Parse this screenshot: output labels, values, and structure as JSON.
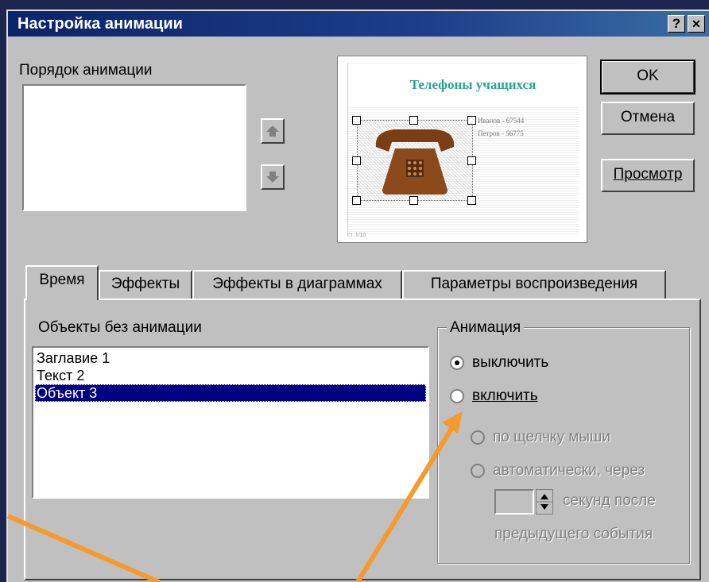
{
  "window": {
    "title": "Настройка анимации",
    "help_label": "?",
    "close_label": "✕"
  },
  "order": {
    "label": "Порядок анимации"
  },
  "buttons": {
    "ok": "OK",
    "cancel": "Отмена",
    "preview": "Просмотр"
  },
  "preview": {
    "slide_title": "Телефоны учащихся",
    "line1": "Иванов - 67544",
    "line2": "Петров - 56775",
    "footer": "ст. 1/10"
  },
  "tabs": [
    {
      "label": "Время"
    },
    {
      "label": "Эффекты"
    },
    {
      "label": "Эффекты в диаграммах"
    },
    {
      "label": "Параметры воспроизведения"
    }
  ],
  "objects": {
    "label": "Объекты без анимации",
    "items": [
      "Заглавие 1",
      "Текст 2",
      "Объект 3"
    ],
    "selected_index": 2
  },
  "animation": {
    "group_title": "Анимация",
    "off_label": "выключить",
    "on_label": "включить",
    "on_click_label": "по щелчку мыши",
    "auto_label": "автоматически, через",
    "seconds_after": "секунд после",
    "previous_event": "предыдущего события",
    "selected": "off"
  },
  "colors": {
    "accent": "#000080",
    "arrow": "#f59a2e",
    "desktop": "#1c2450"
  }
}
